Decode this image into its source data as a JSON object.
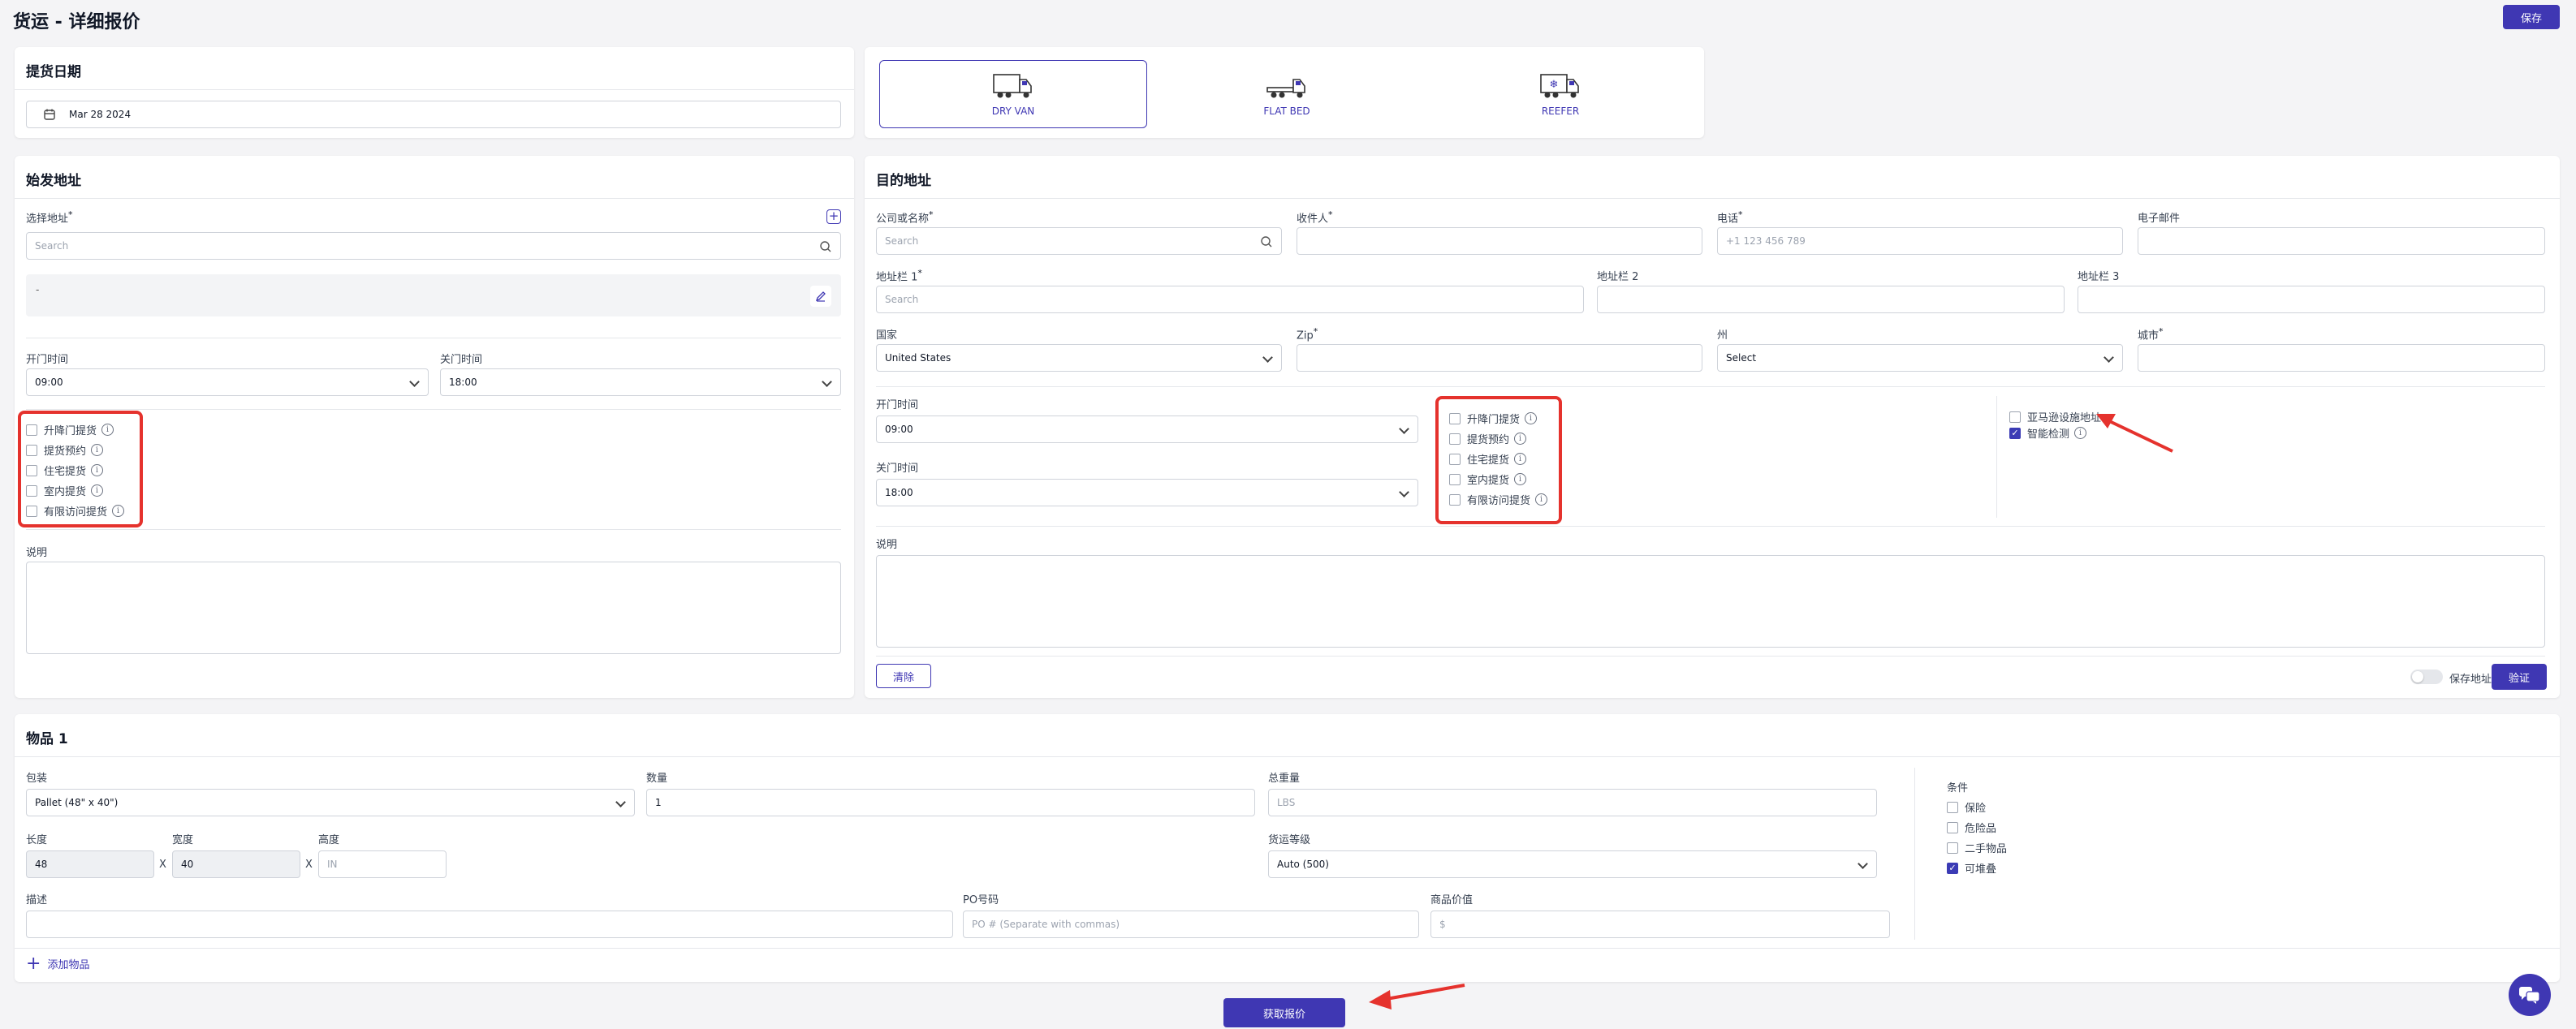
{
  "header": {
    "title": "货运 - 详细报价",
    "save_label": "保存"
  },
  "pickup_date": {
    "title": "提货日期",
    "value": "Mar 28 2024"
  },
  "trailer_types": [
    {
      "label": "DRY VAN",
      "selected": true
    },
    {
      "label": "FLAT BED",
      "selected": false
    },
    {
      "label": "REEFER",
      "selected": false
    }
  ],
  "origin": {
    "title": "始发地址",
    "select_address_label": "选择地址",
    "search_placeholder": "Search",
    "address_preview": "-",
    "open_time_label": "开门时间",
    "open_time_value": "09:00",
    "close_time_label": "关门时间",
    "close_time_value": "18:00",
    "options": [
      {
        "label": "升降门提货",
        "checked": false
      },
      {
        "label": "提货预约",
        "checked": false
      },
      {
        "label": "住宅提货",
        "checked": false
      },
      {
        "label": "室内提货",
        "checked": false
      },
      {
        "label": "有限访问提货",
        "checked": false
      }
    ],
    "notes_label": "说明"
  },
  "destination": {
    "title": "目的地址",
    "company_label": "公司或名称",
    "company_placeholder": "Search",
    "receiver_label": "收件人",
    "phone_label": "电话",
    "phone_placeholder": "+1 123 456 789",
    "email_label": "电子邮件",
    "addr1_label": "地址栏 1",
    "addr1_placeholder": "Search",
    "addr2_label": "地址栏 2",
    "addr3_label": "地址栏 3",
    "country_label": "国家",
    "country_value": "United States",
    "zip_label": "Zip",
    "state_label": "州",
    "state_value": "Select",
    "city_label": "城市",
    "open_time_label": "开门时间",
    "open_time_value": "09:00",
    "close_time_label": "关门时间",
    "close_time_value": "18:00",
    "options": [
      {
        "label": "升降门提货",
        "checked": false
      },
      {
        "label": "提货预约",
        "checked": false
      },
      {
        "label": "住宅提货",
        "checked": false
      },
      {
        "label": "室内提货",
        "checked": false
      },
      {
        "label": "有限访问提货",
        "checked": false
      }
    ],
    "extra_options": [
      {
        "label": "亚马逊设施地址",
        "checked": false
      },
      {
        "label": "智能检测",
        "checked": true
      }
    ],
    "notes_label": "说明",
    "clear_label": "清除",
    "save_address_label": "保存地址",
    "verify_label": "验证"
  },
  "item": {
    "title": "物品 1",
    "packaging_label": "包装",
    "packaging_value": "Pallet (48\" x 40\")",
    "quantity_label": "数量",
    "quantity_value": "1",
    "weight_label": "总重量",
    "weight_placeholder": "LBS",
    "length_label": "长度",
    "length_value": "48",
    "width_label": "宽度",
    "width_value": "40",
    "height_label": "高度",
    "height_placeholder": "IN",
    "times_symbol": "X",
    "class_label": "货运等级",
    "class_value": "Auto (500)",
    "description_label": "描述",
    "po_label": "PO号码",
    "po_placeholder": "PO # (Separate with commas)",
    "value_label": "商品价值",
    "value_placeholder": "$",
    "conditions_label": "条件",
    "conditions": [
      {
        "label": "保险",
        "checked": false
      },
      {
        "label": "危险品",
        "checked": false
      },
      {
        "label": "二手物品",
        "checked": false
      },
      {
        "label": "可堆叠",
        "checked": true
      }
    ],
    "add_item_label": "添加物品"
  },
  "footer": {
    "get_quote_label": "获取报价"
  },
  "colors": {
    "accent": "#3f37b3",
    "annotation_red": "#e5322d"
  }
}
